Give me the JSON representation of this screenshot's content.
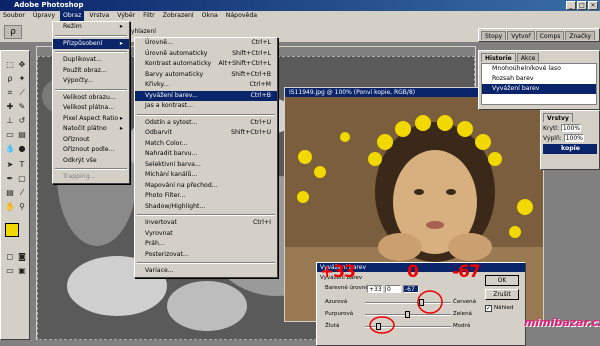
{
  "app": {
    "title": "Adobe Photoshop"
  },
  "menubar": [
    "Soubor",
    "Úpravy",
    "Obraz",
    "Vrstva",
    "Výběr",
    "Filtr",
    "Zobrazení",
    "Okna",
    "Nápověda"
  ],
  "options": {
    "feather_label": "Vyhlazení"
  },
  "doc1": {
    "title": ""
  },
  "doc2": {
    "title": "IS11949.jpg @ 100% (Ponvi kopie, RGB/8)"
  },
  "image_menu": {
    "items": [
      {
        "label": "Režim",
        "sub": true
      },
      {
        "sep": true
      },
      {
        "label": "Přizpůsobení",
        "sub": true,
        "selected": true
      },
      {
        "sep": true
      },
      {
        "label": "Duplikovat..."
      },
      {
        "label": "Použít obraz..."
      },
      {
        "label": "Výpočty..."
      },
      {
        "sep": true
      },
      {
        "label": "Velikost obrazu..."
      },
      {
        "label": "Velikost plátna..."
      },
      {
        "label": "Pixel Aspect Ratio",
        "sub": true
      },
      {
        "label": "Natočit plátno",
        "sub": true
      },
      {
        "label": "Oříznout"
      },
      {
        "label": "Oříznout podle..."
      },
      {
        "label": "Odkrýt vše"
      },
      {
        "sep": true
      },
      {
        "label": "Trapping...",
        "disabled": true
      }
    ]
  },
  "adjust_menu": {
    "items": [
      {
        "label": "Úrovně...",
        "shortcut": "Ctrl+L"
      },
      {
        "label": "Úrovně automaticky",
        "shortcut": "Shift+Ctrl+L"
      },
      {
        "label": "Kontrast automaticky",
        "shortcut": "Alt+Shift+Ctrl+L"
      },
      {
        "label": "Barvy automaticky",
        "shortcut": "Shift+Ctrl+B"
      },
      {
        "label": "Křivky...",
        "shortcut": "Ctrl+M"
      },
      {
        "label": "Vyvážení barev...",
        "shortcut": "Ctrl+B",
        "selected": true
      },
      {
        "label": "Jas a kontrast..."
      },
      {
        "sep": true
      },
      {
        "label": "Odstín a sytost...",
        "shortcut": "Ctrl+U"
      },
      {
        "label": "Odbarvit",
        "shortcut": "Shift+Ctrl+U"
      },
      {
        "label": "Match Color..."
      },
      {
        "label": "Nahradit barvu..."
      },
      {
        "label": "Selektivní barva..."
      },
      {
        "label": "Míchání kanálů..."
      },
      {
        "label": "Mapování na přechod..."
      },
      {
        "label": "Photo Filter..."
      },
      {
        "label": "Shadow/Highlight..."
      },
      {
        "sep": true
      },
      {
        "label": "Invertovat",
        "shortcut": "Ctrl+I"
      },
      {
        "label": "Vyrovnat"
      },
      {
        "label": "Práh..."
      },
      {
        "label": "Posterizovat..."
      },
      {
        "sep": true
      },
      {
        "label": "Variace..."
      }
    ]
  },
  "panels": {
    "tabs_top": [
      "Stopy",
      "Vytvoř",
      "Comps",
      "Značky"
    ],
    "history_tabs": [
      "Historie",
      "Akce"
    ],
    "history_items": [
      "Mnohoúhelníkové laso",
      "Rozsah barev",
      "Vyvážení barev"
    ],
    "layers_tabs": [
      "Vrstvy",
      "Kanály"
    ],
    "layers_opacity_label": "Krytí:",
    "layers_opacity": "100%",
    "layers_fill_label": "Výplň:",
    "layers_fill": "100%",
    "layer_active": "kopie"
  },
  "color_balance": {
    "title": "Vyvážení barev",
    "section": "Vyvážení barev",
    "levels_label": "Barevné úrovně:",
    "levels": [
      "+33",
      "0",
      "-67"
    ],
    "sliders": [
      {
        "left": "Azurová",
        "right": "Červená",
        "value": 33
      },
      {
        "left": "Purpurová",
        "right": "Zelená",
        "value": 0
      },
      {
        "left": "Žlutá",
        "right": "Modrá",
        "value": -67
      }
    ],
    "ok": "OK",
    "cancel": "Zrušit",
    "preview": "Náhled"
  },
  "annotation": {
    "big_numbers": [
      "+33",
      "0",
      "-67"
    ]
  },
  "watermark": "mimibazar.cz",
  "colors": {
    "title_blue": "#0a246a",
    "foreground_swatch": "#f0d800",
    "annotation_red": "#e00000",
    "watermark_pink": "#e0207a"
  }
}
